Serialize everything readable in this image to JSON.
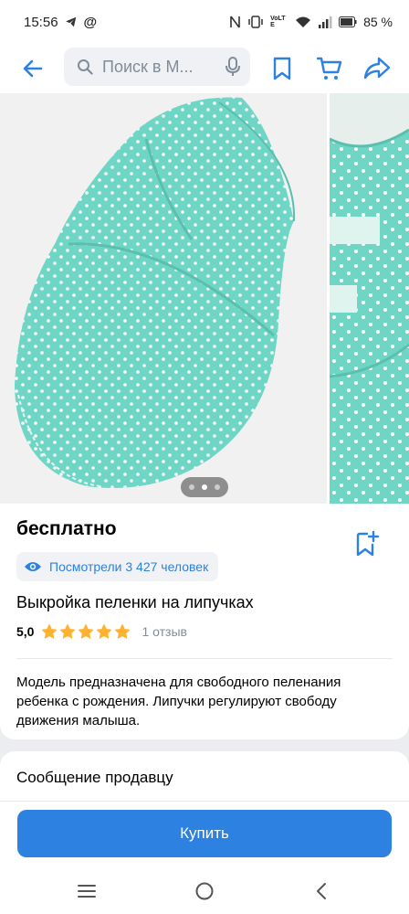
{
  "status_bar": {
    "time": "15:56",
    "battery": "85 %",
    "network_label": "VoLTE",
    "icons": [
      "telegram-icon",
      "at-sign-icon",
      "nfc-icon",
      "vibrate-icon",
      "volte-icon",
      "wifi-icon",
      "signal-icon",
      "battery-icon"
    ]
  },
  "nav": {
    "search_placeholder": "Поиск в М...",
    "icons": [
      "back-arrow-icon",
      "search-icon",
      "microphone-icon",
      "bookmark-icon",
      "cart-icon",
      "share-icon"
    ]
  },
  "gallery": {
    "slide_count": 3,
    "active_slide": 1,
    "fabric_color": "#6fd6c6"
  },
  "product": {
    "price": "бесплатно",
    "views": "Посмотрели 3 427 человек",
    "title": "Выкройка пеленки на липучках",
    "rating_value": "5,0",
    "rating_stars": 5,
    "reviews": "1 отзыв",
    "description": "Модель предназначена для свободного пеленания ребенка с рождения. Липучки регулируют свободу движения малыша."
  },
  "seller": {
    "message_label": "Сообщение продавцу"
  },
  "actions": {
    "buy_label": "Купить"
  },
  "colors": {
    "accent": "#2d81e0",
    "star": "#ffb230",
    "muted": "#818c99"
  }
}
